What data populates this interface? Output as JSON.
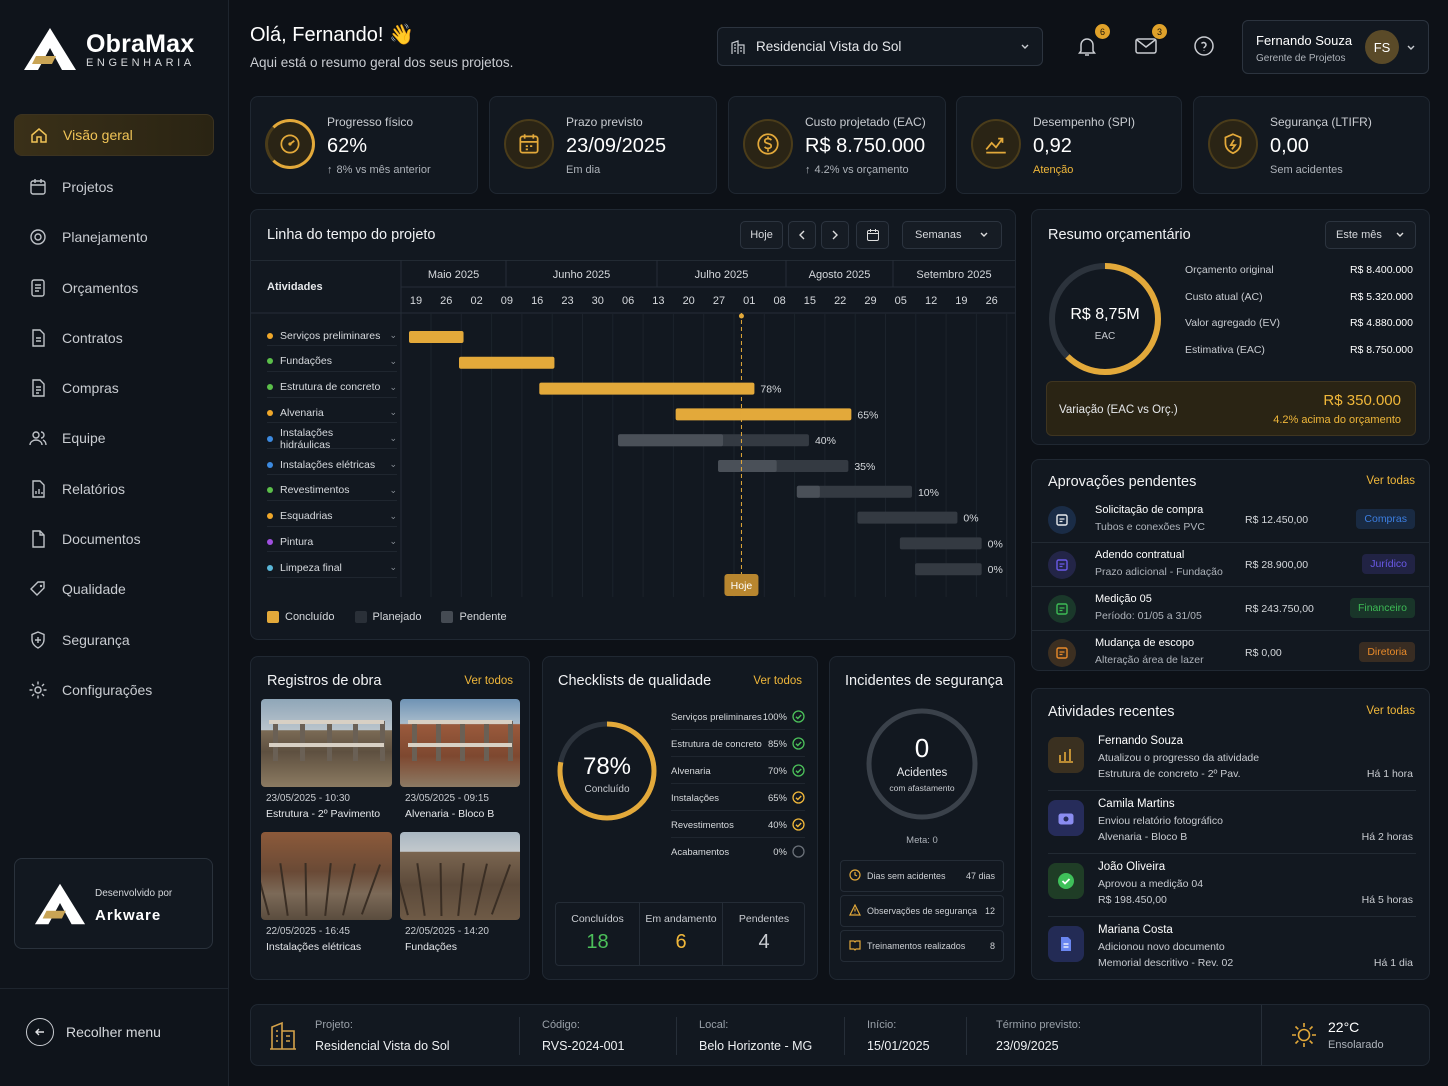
{
  "brand": {
    "name": "ObraMax",
    "subtitle": "ENGENHARIA"
  },
  "nav": [
    {
      "label": "Visão geral",
      "icon": "home-icon",
      "active": true
    },
    {
      "label": "Projetos",
      "icon": "calendar-icon"
    },
    {
      "label": "Planejamento",
      "icon": "target-icon"
    },
    {
      "label": "Orçamentos",
      "icon": "budget-icon"
    },
    {
      "label": "Contratos",
      "icon": "contract-icon"
    },
    {
      "label": "Compras",
      "icon": "document-icon"
    },
    {
      "label": "Equipe",
      "icon": "team-icon"
    },
    {
      "label": "Relatórios",
      "icon": "report-icon"
    },
    {
      "label": "Documentos",
      "icon": "file-icon"
    },
    {
      "label": "Qualidade",
      "icon": "tag-icon"
    },
    {
      "label": "Segurança",
      "icon": "shield-icon"
    },
    {
      "label": "Configurações",
      "icon": "gear-icon"
    }
  ],
  "promo": {
    "caption": "Desenvolvido por",
    "name": "Arkware"
  },
  "collapse_label": "Recolher menu",
  "header": {
    "greeting": "Olá, Fernando! 👋",
    "subtitle": "Aqui está o resumo geral dos seus projetos.",
    "project_select": "Residencial Vista do Sol",
    "notifications": "6",
    "messages": "3",
    "user_name": "Fernando Souza",
    "user_role": "Gerente de Projetos",
    "user_initials": "FS"
  },
  "kpis": [
    {
      "label": "Progresso físico",
      "value": "62%",
      "sub": "8% vs mês anterior",
      "icon": "progress-icon"
    },
    {
      "label": "Prazo previsto",
      "value": "23/09/2025",
      "sub": "Em dia",
      "icon": "calendar-icon"
    },
    {
      "label": "Custo projetado (EAC)",
      "value": "R$ 8.750.000",
      "sub": "4.2% vs orçamento",
      "icon": "dollar-icon"
    },
    {
      "label": "Desempenho (SPI)",
      "value": "0,92",
      "sub": "Atenção",
      "icon": "trend-icon"
    },
    {
      "label": "Segurança (LTIFR)",
      "value": "0,00",
      "sub": "Sem acidentes",
      "icon": "shield-check-icon"
    }
  ],
  "timeline": {
    "title": "Linha do tempo do projeto",
    "today_btn": "Hoje",
    "period": "Semanas",
    "activities_header": "Atividades",
    "months": [
      "Maio 2025",
      "Junho 2025",
      "Julho 2025",
      "Agosto 2025",
      "Setembro 2025"
    ],
    "weeks": [
      "19",
      "26",
      "02",
      "09",
      "16",
      "23",
      "30",
      "06",
      "13",
      "20",
      "27",
      "01",
      "08",
      "15",
      "22",
      "29",
      "05",
      "12",
      "19",
      "26"
    ],
    "today_label": "Hoje",
    "rows": [
      {
        "name": "Serviços preliminares",
        "dot": "#f0a82a",
        "pct": ""
      },
      {
        "name": "Fundações",
        "dot": "#5bbf4a",
        "pct": ""
      },
      {
        "name": "Estrutura de concreto",
        "dot": "#5bbf4a",
        "pct": "78%"
      },
      {
        "name": "Alvenaria",
        "dot": "#f0a82a",
        "pct": "65%"
      },
      {
        "name": "Instalações hidráulicas",
        "dot": "#3c8ae0",
        "pct": "40%"
      },
      {
        "name": "Instalações elétricas",
        "dot": "#3c8ae0",
        "pct": "35%"
      },
      {
        "name": "Revestimentos",
        "dot": "#5bbf4a",
        "pct": "10%"
      },
      {
        "name": "Esquadrias",
        "dot": "#f0a82a",
        "pct": "0%"
      },
      {
        "name": "Pintura",
        "dot": "#a050e0",
        "pct": "0%"
      },
      {
        "name": "Limpeza final",
        "dot": "#5ab7d8",
        "pct": "0%"
      }
    ],
    "legend": [
      "Concluído",
      "Planejado",
      "Pendente"
    ]
  },
  "budget": {
    "title": "Resumo orçamentário",
    "period": "Este mês",
    "donut_value": "R$ 8,75M",
    "donut_label": "EAC",
    "rows": [
      {
        "label": "Orçamento original",
        "value": "R$ 8.400.000"
      },
      {
        "label": "Custo atual (AC)",
        "value": "R$ 5.320.000"
      },
      {
        "label": "Valor agregado (EV)",
        "value": "R$ 4.880.000"
      },
      {
        "label": "Estimativa (EAC)",
        "value": "R$ 8.750.000"
      }
    ],
    "variance_label": "Variação (EAC vs Orç.)",
    "variance_value": "R$ 350.000",
    "variance_note": "4.2% acima do orçamento"
  },
  "approvals": {
    "title": "Aprovações pendentes",
    "link": "Ver todas",
    "items": [
      {
        "title": "Solicitação de compra",
        "sub": "Tubos e conexões PVC",
        "value": "R$ 12.450,00",
        "badge": "Compras",
        "color": "#3c7ee0",
        "icon": "clipboard-icon"
      },
      {
        "title": "Adendo contratual",
        "sub": "Prazo adicional - Fundação",
        "value": "R$ 28.900,00",
        "badge": "Jurídico",
        "color": "#6a5ae8",
        "icon": "contract-icon"
      },
      {
        "title": "Medição 05",
        "sub": "Período: 01/05 a 31/05",
        "value": "R$ 243.750,00",
        "badge": "Financeiro",
        "color": "#3dbb55",
        "icon": "spreadsheet-icon"
      },
      {
        "title": "Mudança de escopo",
        "sub": "Alteração área de lazer",
        "value": "R$ 0,00",
        "badge": "Diretoria",
        "color": "#e88a2a",
        "icon": "scope-icon"
      }
    ]
  },
  "activities": {
    "title": "Atividades recentes",
    "link": "Ver todas",
    "items": [
      {
        "name": "Fernando Souza",
        "line1": "Atualizou o progresso da atividade",
        "line2": "Estrutura de concreto - 2º Pav.",
        "time": "Há 1 hora",
        "icon": "chart-icon",
        "color": "#3a3020"
      },
      {
        "name": "Camila Martins",
        "line1": "Enviou relatório fotográfico",
        "line2": "Alvenaria - Bloco B",
        "time": "Há 2 horas",
        "icon": "camera-icon",
        "color": "#262c5a"
      },
      {
        "name": "João Oliveira",
        "line1": "Aprovou a medição 04",
        "line2": "R$ 198.450,00",
        "time": "Há 5 horas",
        "icon": "check-icon",
        "color": "#1f3d26"
      },
      {
        "name": "Mariana Costa",
        "line1": "Adicionou novo documento",
        "line2": "Memorial descritivo - Rev. 02",
        "time": "Há 1 dia",
        "icon": "doc-icon",
        "color": "#232b55"
      }
    ]
  },
  "records": {
    "title": "Registros de obra",
    "link": "Ver todos",
    "items": [
      {
        "date": "23/05/2025 - 10:30",
        "caption": "Estrutura - 2º Pavimento"
      },
      {
        "date": "23/05/2025 - 09:15",
        "caption": "Alvenaria - Bloco B"
      },
      {
        "date": "22/05/2025 - 16:45",
        "caption": "Instalações elétricas"
      },
      {
        "date": "22/05/2025 - 14:20",
        "caption": "Fundações"
      }
    ]
  },
  "checklists": {
    "title": "Checklists de qualidade",
    "link": "Ver todos",
    "donut_value": "78%",
    "donut_label": "Concluído",
    "items": [
      {
        "name": "Serviços preliminares",
        "pct": "100%",
        "status": "done"
      },
      {
        "name": "Estrutura de concreto",
        "pct": "85%",
        "status": "done"
      },
      {
        "name": "Alvenaria",
        "pct": "70%",
        "status": "done"
      },
      {
        "name": "Instalações",
        "pct": "65%",
        "status": "partial"
      },
      {
        "name": "Revestimentos",
        "pct": "40%",
        "status": "partial"
      },
      {
        "name": "Acabamentos",
        "pct": "0%",
        "status": "none"
      }
    ],
    "stats": [
      {
        "label": "Concluídos",
        "value": "18",
        "color": "#4cc05a"
      },
      {
        "label": "Em andamento",
        "value": "6",
        "color": "#f0b73a"
      },
      {
        "label": "Pendentes",
        "value": "4",
        "color": "#c9ccd1"
      }
    ]
  },
  "incidents": {
    "title": "Incidentes de segurança",
    "count": "0",
    "label": "Acidentes",
    "sublabel": "com afastamento",
    "goal": "Meta: 0",
    "rows": [
      {
        "label": "Dias sem acidentes",
        "value": "47 dias",
        "icon": "clock-icon"
      },
      {
        "label": "Observações de segurança",
        "value": "12",
        "icon": "warning-icon"
      },
      {
        "label": "Treinamentos realizados",
        "value": "8",
        "icon": "book-icon"
      }
    ]
  },
  "footer": {
    "project_label": "Projeto:",
    "project": "Residencial Vista do Sol",
    "code_label": "Código:",
    "code": "RVS-2024-001",
    "location_label": "Local:",
    "location": "Belo Horizonte - MG",
    "start_label": "Início:",
    "start": "15/01/2025",
    "end_label": "Término previsto:",
    "end": "23/09/2025",
    "temp": "22°C",
    "weather": "Ensolarado"
  }
}
